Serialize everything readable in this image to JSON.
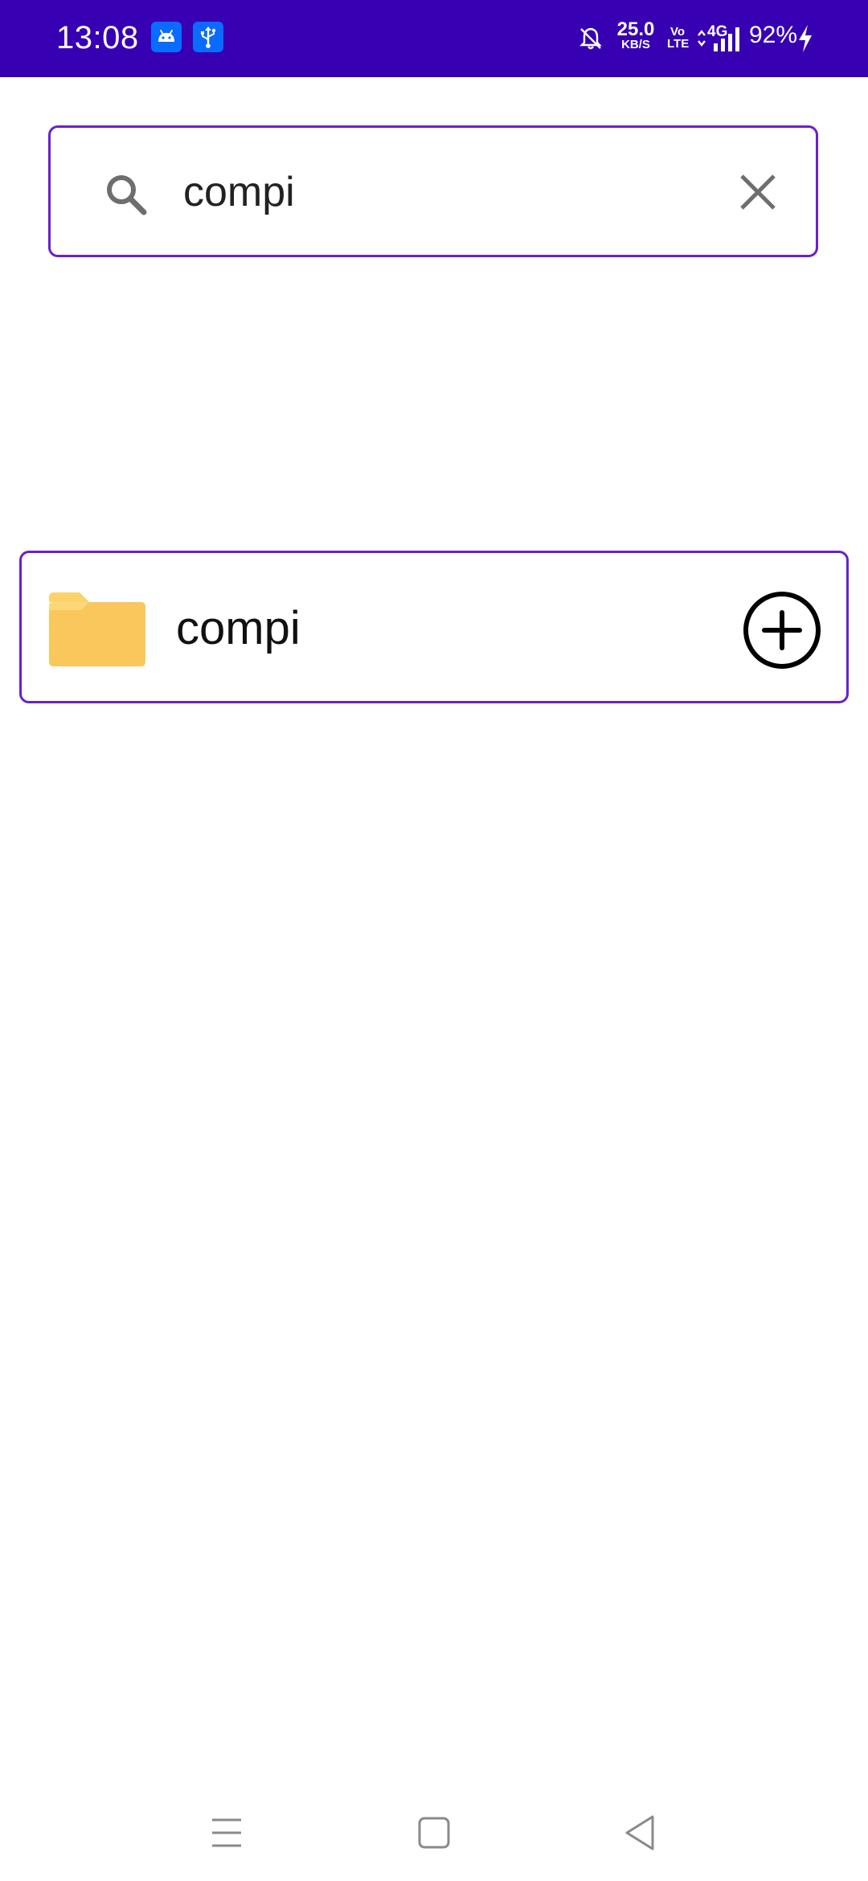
{
  "status_bar": {
    "time": "13:08",
    "notification_icons": [
      "android-icon",
      "usb-icon"
    ],
    "net_speed_value": "25.0",
    "net_speed_unit": "KB/S",
    "volte_top": "Vo",
    "volte_bottom": "LTE",
    "network_type": "4G",
    "battery_percent": "92%",
    "background_color": "#3700b3"
  },
  "search": {
    "value": "compi",
    "border_color": "#6a1fd0"
  },
  "results": [
    {
      "label": "compi",
      "icon": "folder-icon",
      "action_icon": "add-circle-icon"
    }
  ],
  "nav_bar": {
    "buttons": [
      "menu-icon",
      "home-icon",
      "back-icon"
    ]
  }
}
